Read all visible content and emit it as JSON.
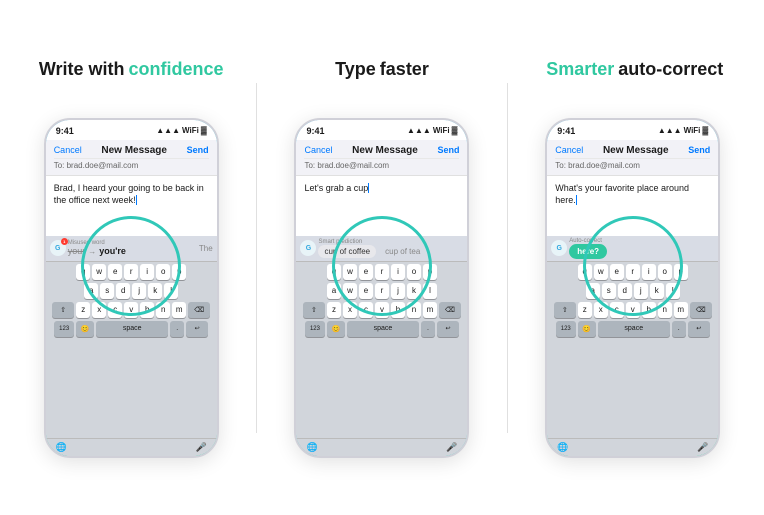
{
  "panels": [
    {
      "id": "panel-1",
      "title_plain": "Write with",
      "title_accent": "confidence",
      "accent_color": "#30c8a0",
      "phone": {
        "status_time": "9:41",
        "mail_cancel": "Cancel",
        "mail_title": "New Message",
        "mail_send": "Send",
        "mail_to": "To: brad.doe@mail.com",
        "message": "Brad, I heard your going to be back in the office next week!",
        "suggestion_label": "Misused word",
        "suggestion_type": "correction",
        "grammarly_has_badge": true,
        "word_wrong": "your",
        "word_right": "you're",
        "word_extra": "The",
        "keyboard_rows": [
          [
            "q",
            "w",
            "e",
            "r",
            "t",
            "y",
            "u",
            "i",
            "o",
            "p"
          ],
          [
            "a",
            "s",
            "d",
            "f",
            "g",
            "h",
            "j",
            "k",
            "l"
          ],
          [
            "⇧",
            "z",
            "x",
            "c",
            "v",
            "b",
            "n",
            "m",
            "⌫"
          ],
          [
            "123",
            "😊",
            "space",
            ".",
            "↩"
          ]
        ]
      }
    },
    {
      "id": "panel-2",
      "title_plain": "Type",
      "title_accent": "faster",
      "accent_color": "#1a1a1a",
      "title_accent_color": "#1a1a1a",
      "title_plain_color": "#1a1a1a",
      "phone": {
        "status_time": "9:41",
        "mail_cancel": "Cancel",
        "mail_title": "New Message",
        "mail_send": "Send",
        "mail_to": "To: brad.doe@mail.com",
        "message": "Let's grab a cup",
        "suggestion_label": "Smart prediction",
        "suggestion_type": "prediction",
        "grammarly_has_badge": false,
        "word_prediction": "cup of coffee",
        "word_alt": "cup of tea",
        "keyboard_rows": [
          [
            "q",
            "w",
            "e",
            "r",
            "t",
            "y",
            "u",
            "i",
            "o",
            "p"
          ],
          [
            "a",
            "s",
            "d",
            "f",
            "g",
            "h",
            "j",
            "k",
            "l"
          ],
          [
            "⇧",
            "z",
            "x",
            "c",
            "v",
            "b",
            "n",
            "m",
            "⌫"
          ],
          [
            "123",
            "😊",
            "space",
            ".",
            "↩"
          ]
        ]
      }
    },
    {
      "id": "panel-3",
      "title_plain": "auto-correct",
      "title_accent": "Smarter",
      "accent_color": "#30c8a0",
      "phone": {
        "status_time": "9:41",
        "mail_cancel": "Cancel",
        "mail_title": "New Message",
        "mail_send": "Send",
        "mail_to": "To: brad.doe@mail.com",
        "message": "What's your favorite place around here.",
        "suggestion_label": "Auto-correct",
        "suggestion_type": "autocorrect",
        "grammarly_has_badge": false,
        "autocorrect_word": "here?",
        "keyboard_rows": [
          [
            "q",
            "w",
            "e",
            "r",
            "t",
            "y",
            "u",
            "i",
            "o",
            "p"
          ],
          [
            "a",
            "s",
            "d",
            "f",
            "g",
            "h",
            "j",
            "k",
            "l"
          ],
          [
            "⇧",
            "z",
            "x",
            "c",
            "v",
            "b",
            "n",
            "m",
            "⌫"
          ],
          [
            "123",
            "😊",
            "space",
            ".",
            "↩"
          ]
        ]
      }
    }
  ]
}
